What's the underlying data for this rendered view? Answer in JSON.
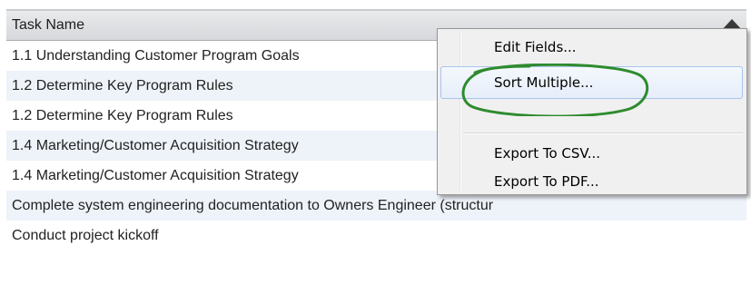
{
  "grid": {
    "column_header": "Task Name",
    "rows": [
      "1.1 Understanding Customer Program Goals",
      "1.2 Determine Key Program Rules",
      "1.2 Determine Key Program Rules",
      "1.4 Marketing/Customer Acquisition Strategy",
      "1.4 Marketing/Customer Acquisition Strategy",
      "Complete system engineering documentation to Owners Engineer (structur",
      "Conduct project kickoff"
    ]
  },
  "context_menu": {
    "items": [
      {
        "label": "Edit Fields..."
      },
      {
        "label": "Sort Multiple..."
      },
      {
        "label": "Export To CSV..."
      },
      {
        "label": "Export To PDF..."
      }
    ]
  },
  "colors": {
    "row_alt": "#eef3fa",
    "highlight_circle": "#2e8b2e",
    "hover_border": "#a8c4ec"
  }
}
